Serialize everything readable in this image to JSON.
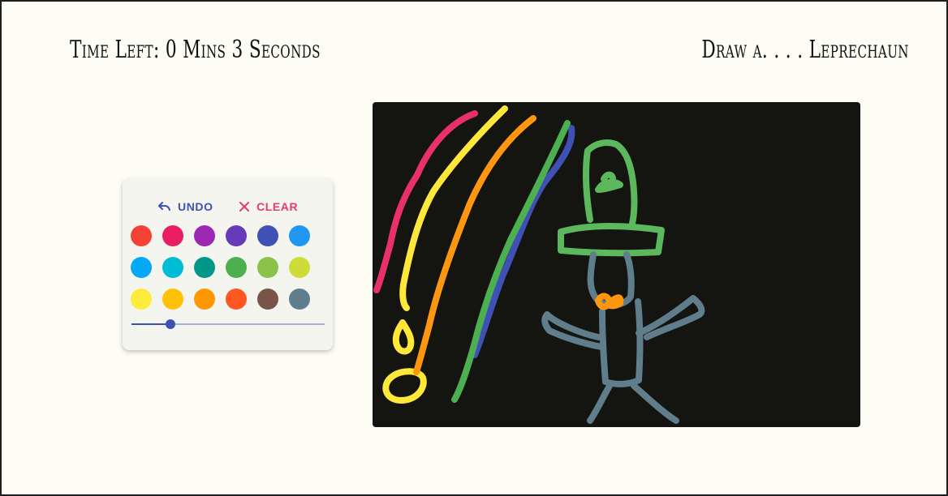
{
  "header": {
    "time_left": "Time Left: 0 Mins 3 Seconds",
    "prompt": "Draw a. . . . Leprechaun"
  },
  "toolbox": {
    "undo_label": "UNDO",
    "clear_label": "CLEAR",
    "undo_icon": "undo-arrow-icon",
    "clear_icon": "close-x-icon",
    "palette": [
      "#f44336",
      "#e91e63",
      "#9c27b0",
      "#673ab7",
      "#3f51b5",
      "#2196f3",
      "#03a9f4",
      "#00bcd4",
      "#009688",
      "#4caf50",
      "#8bc34a",
      "#cddc39",
      "#ffeb3b",
      "#ffc107",
      "#ff9800",
      "#ff5722",
      "#795548",
      "#607d8b"
    ],
    "brush_size_fraction": 0.2
  },
  "colors": {
    "accent": "#3f51b5",
    "clear": "#e53d66",
    "canvas_bg": "#141410",
    "page_bg": "#fdfdf4"
  }
}
